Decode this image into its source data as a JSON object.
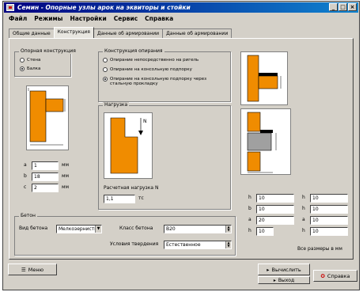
{
  "window": {
    "title": "Семин - Опорные узлы арок на эквиторы и стойки"
  },
  "menu": [
    "Файл",
    "Режимы",
    "Настройки",
    "Сервис",
    "Справка"
  ],
  "tabs": [
    "Общие данные",
    "Конструкция",
    "Данные об армировании",
    "Данные об армировании"
  ],
  "groups": {
    "support": "Опорная конструкция",
    "construction": "Конструкция опирания",
    "load": "Нагрузка",
    "concrete": "Бетон"
  },
  "support_options": [
    "Стена",
    "Балка"
  ],
  "construction_options": [
    "Опирание непосредственно на ригель",
    "Опирание на консольную подпорку",
    "Опирание на консольную подпорку через стальную прокладку"
  ],
  "dims": [
    {
      "label": "a",
      "value": "1",
      "unit": "мм"
    },
    {
      "label": "b",
      "value": "18",
      "unit": "мм"
    },
    {
      "label": "c",
      "value": "2",
      "unit": "мм"
    }
  ],
  "load_label": "Расчетная нагрузка N",
  "load_value": "1,1",
  "load_unit": "тс",
  "fig_label": "N",
  "params_left": [
    {
      "label": "h",
      "value": "10"
    },
    {
      "label": "b",
      "value": "10"
    },
    {
      "label": "a",
      "value": "20"
    },
    {
      "label": "h",
      "value": "10"
    }
  ],
  "params_right": [
    {
      "label": "h",
      "value": "10"
    },
    {
      "label": "h",
      "value": "10"
    },
    {
      "label": "a",
      "value": "10"
    },
    {
      "label": "h",
      "value": "10"
    }
  ],
  "units_note": "Все размеры в мм",
  "concrete": {
    "type_label": "Вид бетона",
    "type_value": "Мелкозернистый",
    "class_label": "Класс бетона",
    "class_value": "B20",
    "cond_label": "Условия твердения",
    "cond_value": "Естественное"
  },
  "buttons": {
    "menu": "Меню",
    "calc": "Вычислить",
    "exit": "Выход",
    "help": "Справка"
  },
  "colors": {
    "title_start": "#000080",
    "title_end": "#1084d0",
    "accent": "#f08c00"
  }
}
